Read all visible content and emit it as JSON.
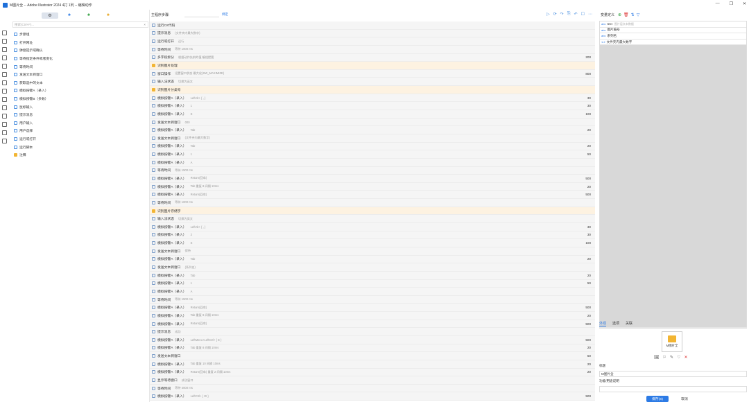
{
  "window": {
    "title": "M图片全 -- Adobe Illustrator 2024 4打 1列 -- 编辑动作",
    "min_glyph": "—",
    "max_glyph": "❐",
    "close_glyph": "✕"
  },
  "left": {
    "tabs": [
      {
        "label": "⚙",
        "name": "settings"
      },
      {
        "label": "♣",
        "name": "blue-clover"
      },
      {
        "label": "♣",
        "name": "green-clover"
      },
      {
        "label": "♣",
        "name": "orange-clover"
      }
    ],
    "search_placeholder": "搜索(Ctrl+F)...",
    "search_clear": "×",
    "commands": [
      "步骤组",
      "打开网址",
      "弹窗提示或确认",
      "等待指定条件或者变化",
      "等待时间",
      "发送文本到窗口",
      "获取选中的文本",
      "模拟按键A（录入）",
      "模拟按键B（多数）",
      "鼠标输入",
      "提示消息",
      "用户输入",
      "用户选择",
      "运行或打开",
      "运行脚本",
      "注释"
    ]
  },
  "main": {
    "sub_label": "主程序步骤:",
    "bind_link": "绑定",
    "toolbar_icons": [
      "▷",
      "⟳",
      "↷",
      "⎘",
      "↶",
      "☐",
      "⋯"
    ],
    "rows": [
      {
        "label": "运行C#代码",
        "desc": "",
        "value": "",
        "group": false
      },
      {
        "label": "提示消息",
        "desc": "(文件夹内最大数字)",
        "value": "",
        "group": false
      },
      {
        "label": "运行或打开",
        "desc": "运行",
        "value": "",
        "group": false
      },
      {
        "label": "等待时间",
        "desc": "等待 1000 ms",
        "value": "",
        "group": false
      },
      {
        "label": "多字段拆分",
        "desc": "根据动作先前的值 编组提要",
        "value": "200",
        "group": false
      },
      {
        "label": "识别图片处理",
        "desc": "",
        "value": "",
        "group": true
      },
      {
        "label": "窗口操作",
        "desc": "设置窗口状态 最大化(SW_MAXIMIZE)",
        "value": "800",
        "group": false
      },
      {
        "label": "输入法状态",
        "desc": "切换为英文",
        "value": "",
        "group": false
      },
      {
        "label": "识别图片分类号",
        "desc": "",
        "value": "",
        "group": true
      },
      {
        "label": "模拟按键A（录入）",
        "desc": "LeftAlt+ { , }",
        "value": "30",
        "group": false
      },
      {
        "label": "模拟按键A（录入）",
        "desc": "1",
        "value": "30",
        "group": false
      },
      {
        "label": "模拟按键A（录入）",
        "desc": "E",
        "value": "100",
        "group": false
      },
      {
        "label": "发送文本到窗口",
        "desc": "000",
        "value": "",
        "group": false
      },
      {
        "label": "模拟按键A（录入）",
        "desc": "Tab",
        "value": "20",
        "group": false
      },
      {
        "label": "发送文本到窗口",
        "desc": "(文件夹内最大数字)",
        "value": "",
        "group": false
      },
      {
        "label": "模拟按键A（录入）",
        "desc": "Tab",
        "value": "20",
        "group": false
      },
      {
        "label": "模拟按键A（录入）",
        "desc": "1",
        "value": "50",
        "group": false
      },
      {
        "label": "模拟按键A（录入）",
        "desc": "A",
        "value": "",
        "group": false
      },
      {
        "label": "等待时间",
        "desc": "等待 1500 ms",
        "value": "",
        "group": false
      },
      {
        "label": "模拟按键A（录入）",
        "desc": "Return(回车)",
        "value": "500",
        "group": false
      },
      {
        "label": "模拟按键A（录入）",
        "desc": "Tab 重复 8 间隔 10ms",
        "value": "20",
        "group": false
      },
      {
        "label": "模拟按键A（录入）",
        "desc": "Return(回车)",
        "value": "500",
        "group": false
      },
      {
        "label": "等待时间",
        "desc": "等待 1000 ms",
        "value": "",
        "group": false
      },
      {
        "label": "识别图片存储字",
        "desc": "",
        "value": "",
        "group": true
      },
      {
        "label": "输入法状态",
        "desc": "切换为英文",
        "value": "",
        "group": false
      },
      {
        "label": "模拟按键A（录入）",
        "desc": "LeftAlt+ { , }",
        "value": "30",
        "group": false
      },
      {
        "label": "模拟按键A（录入）",
        "desc": "2",
        "value": "30",
        "group": false
      },
      {
        "label": "模拟按键A（录入）",
        "desc": "E",
        "value": "100",
        "group": false
      },
      {
        "label": "发送文本到窗口",
        "desc": "保持",
        "value": "",
        "group": false
      },
      {
        "label": "模拟按键A（录入）",
        "desc": "Tab",
        "value": "20",
        "group": false
      },
      {
        "label": "发送文本到窗口",
        "desc": "(系列名)",
        "value": "",
        "group": false
      },
      {
        "label": "模拟按键A（录入）",
        "desc": "Tab",
        "value": "20",
        "group": false
      },
      {
        "label": "模拟按键A（录入）",
        "desc": "1",
        "value": "50",
        "group": false
      },
      {
        "label": "模拟按键A（录入）",
        "desc": "A",
        "value": "",
        "group": false
      },
      {
        "label": "等待时间",
        "desc": "等待 1500 ms",
        "value": "",
        "group": false
      },
      {
        "label": "模拟按键A（录入）",
        "desc": "Return(回车)",
        "value": "500",
        "group": false
      },
      {
        "label": "模拟按键A（录入）",
        "desc": "Tab 重复 8 间隔 10ms",
        "value": "20",
        "group": false
      },
      {
        "label": "模拟按键A（录入）",
        "desc": "Return(回车)",
        "value": "500",
        "group": false
      },
      {
        "label": "提示消息",
        "desc": "成功",
        "value": "",
        "group": false
      },
      {
        "label": "模拟按键A（录入）",
        "desc": "LeftMenu+LeftCtrl+ { E }",
        "value": "500",
        "group": false
      },
      {
        "label": "模拟按键A（录入）",
        "desc": "Tab 重复 8 间隔 10ms",
        "value": "20",
        "group": false
      },
      {
        "label": "发送文本到窗口",
        "desc": "",
        "value": "50",
        "group": false
      },
      {
        "label": "模拟按键A（录入）",
        "desc": "Tab 重复 10 间隔 10ms",
        "value": "20",
        "group": false
      },
      {
        "label": "模拟按键A（录入）",
        "desc": "Return(回车) 重复 2 间隔 10ms",
        "value": "20",
        "group": false
      },
      {
        "label": "显示等待窗口",
        "desc": "成功窗口",
        "value": "",
        "group": false
      },
      {
        "label": "等待时间",
        "desc": "等待 4000 ms",
        "value": "",
        "group": false
      },
      {
        "label": "模拟按键A（录入）",
        "desc": "LeftCtrl+ { W }",
        "value": "500",
        "group": false
      }
    ]
  },
  "right": {
    "var_title": "变量定义",
    "var_icons": [
      "⊕",
      "🗑",
      "⇅",
      "▽"
    ],
    "variables": [
      {
        "type": "abc",
        "name": "text",
        "desc": "图片层文本数据"
      },
      {
        "type": "abc",
        "name": "图片编号",
        "desc": ""
      },
      {
        "type": "abc",
        "name": "系列名",
        "desc": ""
      },
      {
        "type": "1.2",
        "name": "文件夹内最大数字",
        "desc": ""
      }
    ],
    "prop_tabs": [
      "外观",
      "选项",
      "关联"
    ],
    "icon_label": "M图片全",
    "icon_actions": [
      "🖼",
      "⚐",
      "✎",
      "♡",
      "✕"
    ],
    "title_label": "标题",
    "title_value": "M图片全",
    "desc_label": "功能/用途说明",
    "desc_value": "",
    "save_label": "保存(S)",
    "cancel_label": "取消"
  }
}
